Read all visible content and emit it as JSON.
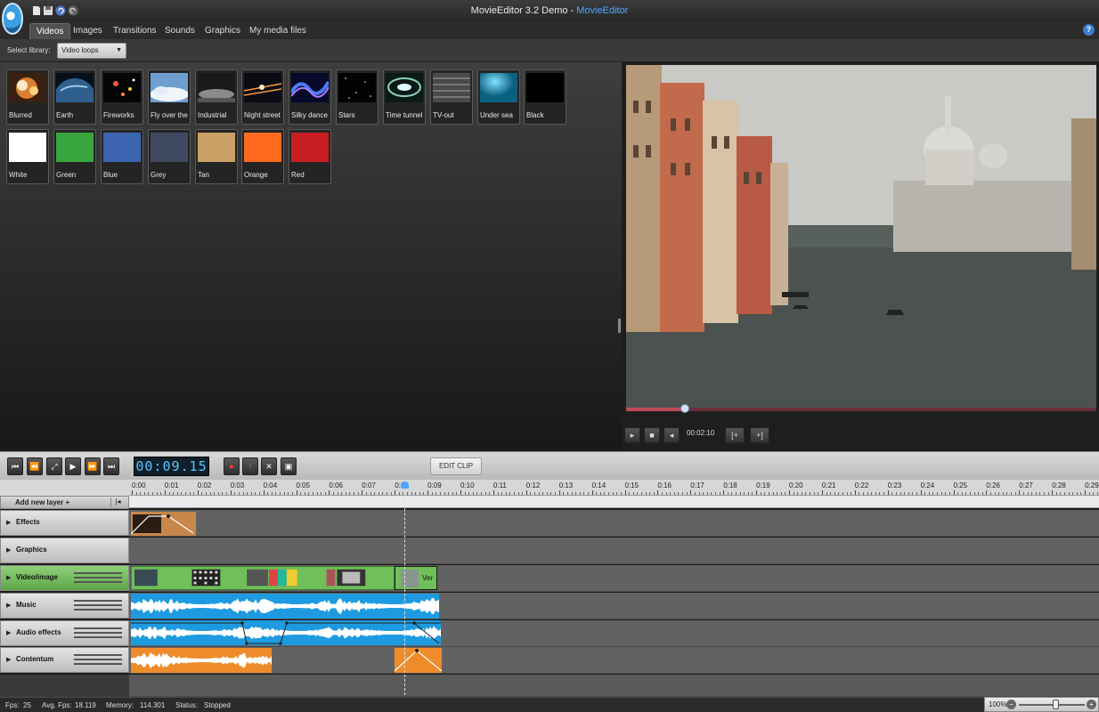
{
  "window": {
    "title_main": "MovieEditor 3.2 Demo - ",
    "title_accent": "MovieEditor",
    "help_label": "?"
  },
  "tabs": [
    {
      "label": "Videos",
      "active": true
    },
    {
      "label": "Images"
    },
    {
      "label": "Transitions"
    },
    {
      "label": "Sounds"
    },
    {
      "label": "Graphics"
    },
    {
      "label": "My media files"
    }
  ],
  "library": {
    "select_label": "Select library:",
    "selected": "Video loops",
    "items": [
      {
        "name": "Blurred",
        "icon": "blurred-thumbnail"
      },
      {
        "name": "Earth",
        "icon": "earth-thumbnail"
      },
      {
        "name": "Fireworks",
        "icon": "fireworks-thumbnail"
      },
      {
        "name": "Fly over the",
        "icon": "sky-thumbnail"
      },
      {
        "name": "Industrial",
        "icon": "industrial-thumbnail"
      },
      {
        "name": "Night street",
        "icon": "night-street-thumbnail"
      },
      {
        "name": "Silky dance",
        "icon": "silky-dance-thumbnail"
      },
      {
        "name": "Stars",
        "icon": "stars-thumbnail"
      },
      {
        "name": "Time tunnel",
        "icon": "time-tunnel-thumbnail"
      },
      {
        "name": "TV-out",
        "icon": "tv-out-thumbnail"
      },
      {
        "name": "Under sea",
        "icon": "under-sea-thumbnail"
      },
      {
        "name": "Black",
        "color": "#000000"
      },
      {
        "name": "White",
        "color": "#ffffff"
      },
      {
        "name": "Green",
        "color": "#3aa63f"
      },
      {
        "name": "Blue",
        "color": "#3b64b1"
      },
      {
        "name": "Grey",
        "color": "#3f4a60"
      },
      {
        "name": "Tan",
        "color": "#c9a065"
      },
      {
        "name": "Orange",
        "color": "#ff6a1f"
      },
      {
        "name": "Red",
        "color": "#c81e22"
      }
    ]
  },
  "preview": {
    "time": "00:02:10",
    "progress": 0.12,
    "buttons": [
      "play-icon",
      "stop-icon",
      "volume-icon",
      "mark-in-icon",
      "mark-out-icon"
    ]
  },
  "timeline": {
    "timecode": "00:09.15",
    "edit_clip_label": "EDIT CLIP",
    "transport_buttons": [
      "skip-start-icon",
      "rewind-icon",
      "fullscreen-icon",
      "play-icon",
      "fast-forward-icon",
      "skip-end-icon"
    ],
    "tool_buttons": [
      "record-icon",
      "split-icon",
      "delete-icon",
      "snapshot-icon"
    ],
    "ruler_ticks": [
      "0:00",
      "0:01",
      "0:02",
      "0:03",
      "0:04",
      "0:05",
      "0:06",
      "0:07",
      "0:08",
      "0:09",
      "0:10",
      "0:11",
      "0:12",
      "0:13",
      "0:14",
      "0:15",
      "0:16",
      "0:17",
      "0:18",
      "0:19",
      "0:20",
      "0:21",
      "0:22",
      "0:23",
      "0:24",
      "0:25",
      "0:26",
      "0:27",
      "0:28",
      "0:29"
    ],
    "add_layer_label": "Add new layer +",
    "tracks": [
      {
        "name": "Effects",
        "has_volume": false
      },
      {
        "name": "Graphics",
        "has_volume": false
      },
      {
        "name": "Video/image",
        "has_volume": true,
        "highlight": true
      },
      {
        "name": "Music",
        "has_volume": true
      },
      {
        "name": "Audio effects",
        "has_volume": true
      },
      {
        "name": "Contentum",
        "has_volume": true
      }
    ],
    "video_clip_label": "Ver",
    "colors": {
      "video": "#6fbf5a",
      "audio": "#1e9be0",
      "effect": "#c7874a",
      "content": "#ee8c2b"
    }
  },
  "status": {
    "fps_label": "Fps:",
    "fps_value": "25",
    "avg_label": "Avg. Fps:",
    "avg_value": "18.119",
    "memory_label": "Memory:",
    "memory_value": "114.301",
    "status_label": "Status:",
    "status_value": "Stopped",
    "zoom": "100%"
  }
}
